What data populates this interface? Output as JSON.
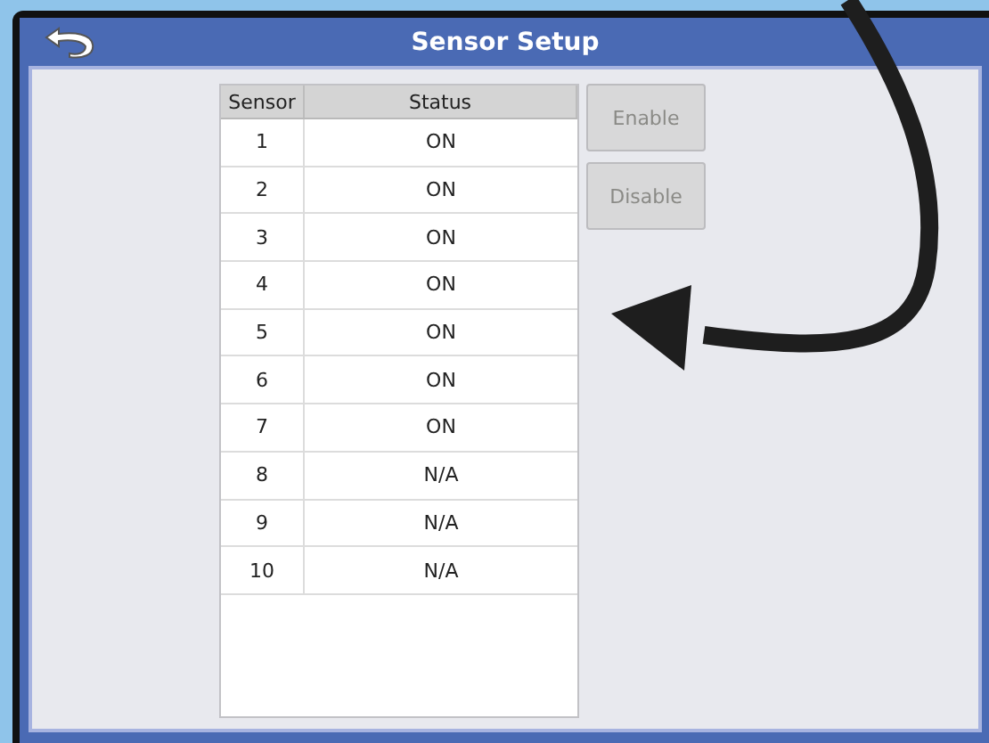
{
  "window": {
    "title": "Sensor Setup"
  },
  "table": {
    "columns": [
      "Sensor",
      "Status"
    ],
    "rows": [
      {
        "sensor": "1",
        "status": "ON"
      },
      {
        "sensor": "2",
        "status": "ON"
      },
      {
        "sensor": "3",
        "status": "ON"
      },
      {
        "sensor": "4",
        "status": "ON"
      },
      {
        "sensor": "5",
        "status": "ON"
      },
      {
        "sensor": "6",
        "status": "ON"
      },
      {
        "sensor": "7",
        "status": "ON"
      },
      {
        "sensor": "8",
        "status": "N/A"
      },
      {
        "sensor": "9",
        "status": "N/A"
      },
      {
        "sensor": "10",
        "status": "N/A"
      }
    ]
  },
  "buttons": [
    {
      "label": "Enable",
      "disabled": true
    },
    {
      "label": "Disable",
      "disabled": true
    }
  ]
}
